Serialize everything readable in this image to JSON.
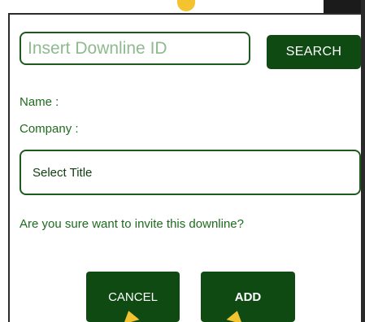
{
  "dialog": {
    "downline_id": {
      "placeholder": "Insert Downline ID",
      "value": ""
    },
    "search_label": "SEARCH",
    "name_label": "Name :",
    "company_label": "Company :",
    "title_select": {
      "selected": "Select Title"
    },
    "confirm_text": "Are you sure want to invite this downline?",
    "cancel_label": "CANCEL",
    "add_label": "ADD"
  },
  "colors": {
    "primary": "#0f4a12",
    "text_green": "#1e6b1e",
    "placeholder_green": "#8fb98f",
    "pointer": "#f4c430"
  },
  "icons": {
    "pointer_top": "pointer-icon",
    "pointer_bottom": "pointer-icon"
  }
}
